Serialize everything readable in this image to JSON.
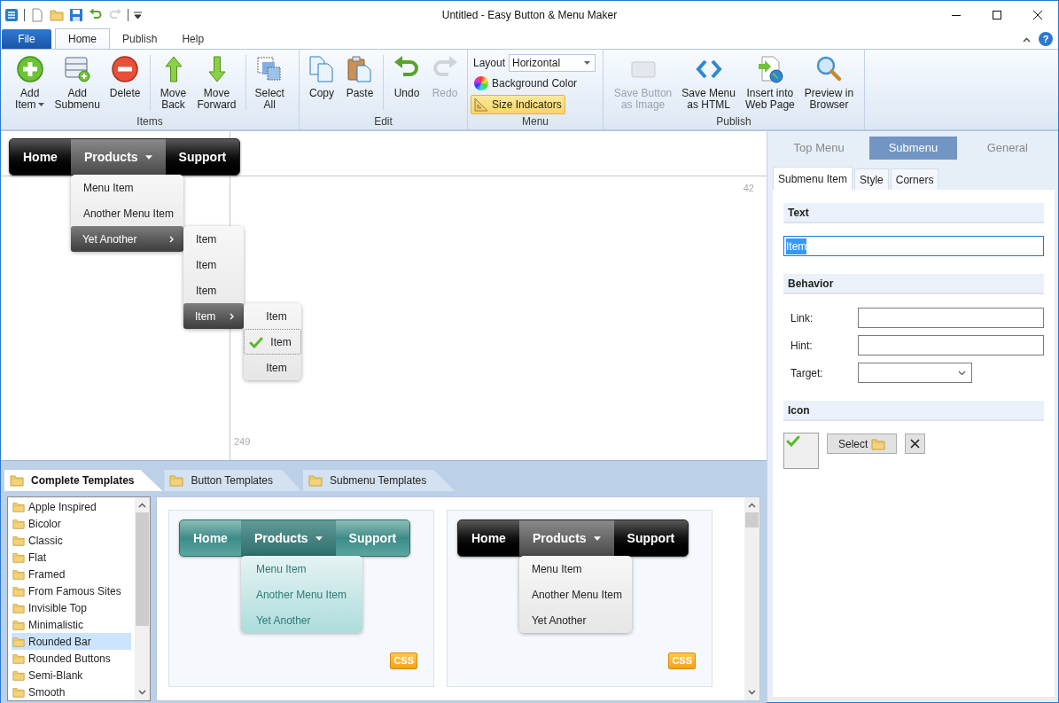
{
  "window": {
    "title": "Untitled - Easy Button & Menu Maker"
  },
  "ribbon_tabs": [
    {
      "label": "File",
      "kind": "file",
      "selected": false
    },
    {
      "label": "Home",
      "kind": "tab",
      "selected": true
    },
    {
      "label": "Publish",
      "kind": "tab",
      "selected": false
    },
    {
      "label": "Help",
      "kind": "tab",
      "selected": false
    }
  ],
  "help_button": "?",
  "ribbon_groups": [
    {
      "label": "Items",
      "items": [
        {
          "kind": "button",
          "label": "Add\nItem",
          "dropdown": true,
          "disabled": false
        },
        {
          "kind": "button",
          "label": "Add\nSubmenu",
          "dropdown": false,
          "disabled": false
        },
        {
          "kind": "button",
          "label": "Delete",
          "dropdown": false,
          "disabled": false
        },
        {
          "kind": "separator"
        },
        {
          "kind": "button",
          "label": "Move\nBack",
          "dropdown": false,
          "disabled": false
        },
        {
          "kind": "button",
          "label": "Move\nForward",
          "dropdown": false,
          "disabled": false
        },
        {
          "kind": "separator"
        },
        {
          "kind": "button",
          "label": "Select\nAll",
          "dropdown": false,
          "disabled": false
        }
      ]
    },
    {
      "label": "Edit",
      "items": [
        {
          "kind": "button",
          "label": "Copy",
          "dropdown": false,
          "disabled": false
        },
        {
          "kind": "button",
          "label": "Paste",
          "dropdown": false,
          "disabled": false
        },
        {
          "kind": "separator"
        },
        {
          "kind": "button",
          "label": "Undo",
          "dropdown": false,
          "disabled": false
        },
        {
          "kind": "button",
          "label": "Redo",
          "dropdown": false,
          "disabled": true
        }
      ]
    },
    {
      "label": "Menu",
      "items": [
        {
          "kind": "select",
          "label": "Layout",
          "value": "Horizontal"
        },
        {
          "kind": "toggle",
          "label": "Background Color",
          "checked": false
        },
        {
          "kind": "toggle",
          "label": "Size Indicators",
          "checked": true
        }
      ]
    },
    {
      "label": "Publish",
      "items": [
        {
          "kind": "button",
          "label": "Save Button\nas Image",
          "dropdown": false,
          "disabled": true
        },
        {
          "kind": "button",
          "label": "Save Menu\nas HTML",
          "dropdown": false,
          "disabled": false
        },
        {
          "kind": "button",
          "label": "Insert into\nWeb Page",
          "dropdown": false,
          "disabled": false
        },
        {
          "kind": "button",
          "label": "Preview in\nBrowser",
          "dropdown": false,
          "disabled": false
        }
      ]
    }
  ],
  "canvas": {
    "ruler_x_label": "42",
    "ruler_y_label": "249",
    "menu": {
      "kind": "black",
      "items": [
        {
          "label": "Home",
          "selected": false
        },
        {
          "label": "Products",
          "selected": true,
          "children": [
            {
              "label": "Menu Item",
              "selected": false
            },
            {
              "label": "Another Menu Item",
              "selected": false
            },
            {
              "label": "Yet Another",
              "selected": true,
              "children": [
                {
                  "label": "Item",
                  "selected": false
                },
                {
                  "label": "Item",
                  "selected": false
                },
                {
                  "label": "Item",
                  "selected": false
                },
                {
                  "label": "Item",
                  "selected": true,
                  "children": [
                    {
                      "label": "Item",
                      "selected": false,
                      "checked": false
                    },
                    {
                      "label": "Item",
                      "selected": true,
                      "checked": true
                    },
                    {
                      "label": "Item",
                      "selected": false,
                      "checked": false
                    }
                  ]
                }
              ]
            }
          ]
        },
        {
          "label": "Support",
          "selected": false
        }
      ]
    }
  },
  "templates": {
    "tabs": [
      {
        "label": "Complete Templates",
        "selected": true
      },
      {
        "label": "Button Templates",
        "selected": false
      },
      {
        "label": "Submenu Templates",
        "selected": false
      }
    ],
    "list": [
      {
        "label": "Apple Inspired",
        "selected": false
      },
      {
        "label": "Bicolor",
        "selected": false
      },
      {
        "label": "Classic",
        "selected": false
      },
      {
        "label": "Flat",
        "selected": false
      },
      {
        "label": "Framed",
        "selected": false
      },
      {
        "label": "From Famous Sites",
        "selected": false
      },
      {
        "label": "Invisible Top",
        "selected": false
      },
      {
        "label": "Minimalistic",
        "selected": false
      },
      {
        "label": "Rounded Bar",
        "selected": true
      },
      {
        "label": "Rounded Buttons",
        "selected": false
      },
      {
        "label": "Semi-Blank",
        "selected": false
      },
      {
        "label": "Smooth",
        "selected": false
      }
    ],
    "previews": [
      {
        "kind": "teal",
        "badge": "CSS",
        "items": [
          {
            "label": "Home",
            "selected": false
          },
          {
            "label": "Products",
            "selected": true,
            "children": [
              {
                "label": "Menu Item",
                "selected": false
              },
              {
                "label": "Another Menu Item",
                "selected": false
              },
              {
                "label": "Yet Another",
                "selected": false
              }
            ]
          },
          {
            "label": "Support",
            "selected": false
          }
        ]
      },
      {
        "kind": "black",
        "badge": "CSS",
        "items": [
          {
            "label": "Home",
            "selected": false
          },
          {
            "label": "Products",
            "selected": true,
            "children": [
              {
                "label": "Menu Item",
                "selected": false
              },
              {
                "label": "Another Menu Item",
                "selected": false
              },
              {
                "label": "Yet Another",
                "selected": false
              }
            ]
          },
          {
            "label": "Support",
            "selected": false
          }
        ]
      }
    ]
  },
  "properties": {
    "tabs": [
      {
        "label": "Top Menu",
        "selected": false
      },
      {
        "label": "Submenu",
        "selected": true
      },
      {
        "label": "General",
        "selected": false
      }
    ],
    "subtabs": [
      {
        "label": "Submenu Item",
        "selected": true
      },
      {
        "label": "Style",
        "selected": false
      },
      {
        "label": "Corners",
        "selected": false
      }
    ],
    "sections": [
      {
        "kind": "text",
        "title": "Text",
        "value": "Item",
        "value_selected": true
      },
      {
        "kind": "fields",
        "title": "Behavior",
        "fields": [
          {
            "kind": "text",
            "label": "Link:"
          },
          {
            "kind": "text",
            "label": "Hint:"
          },
          {
            "kind": "select",
            "label": "Target:"
          }
        ]
      },
      {
        "kind": "icon",
        "title": "Icon",
        "has_icon": true,
        "button": "Select"
      }
    ]
  }
}
